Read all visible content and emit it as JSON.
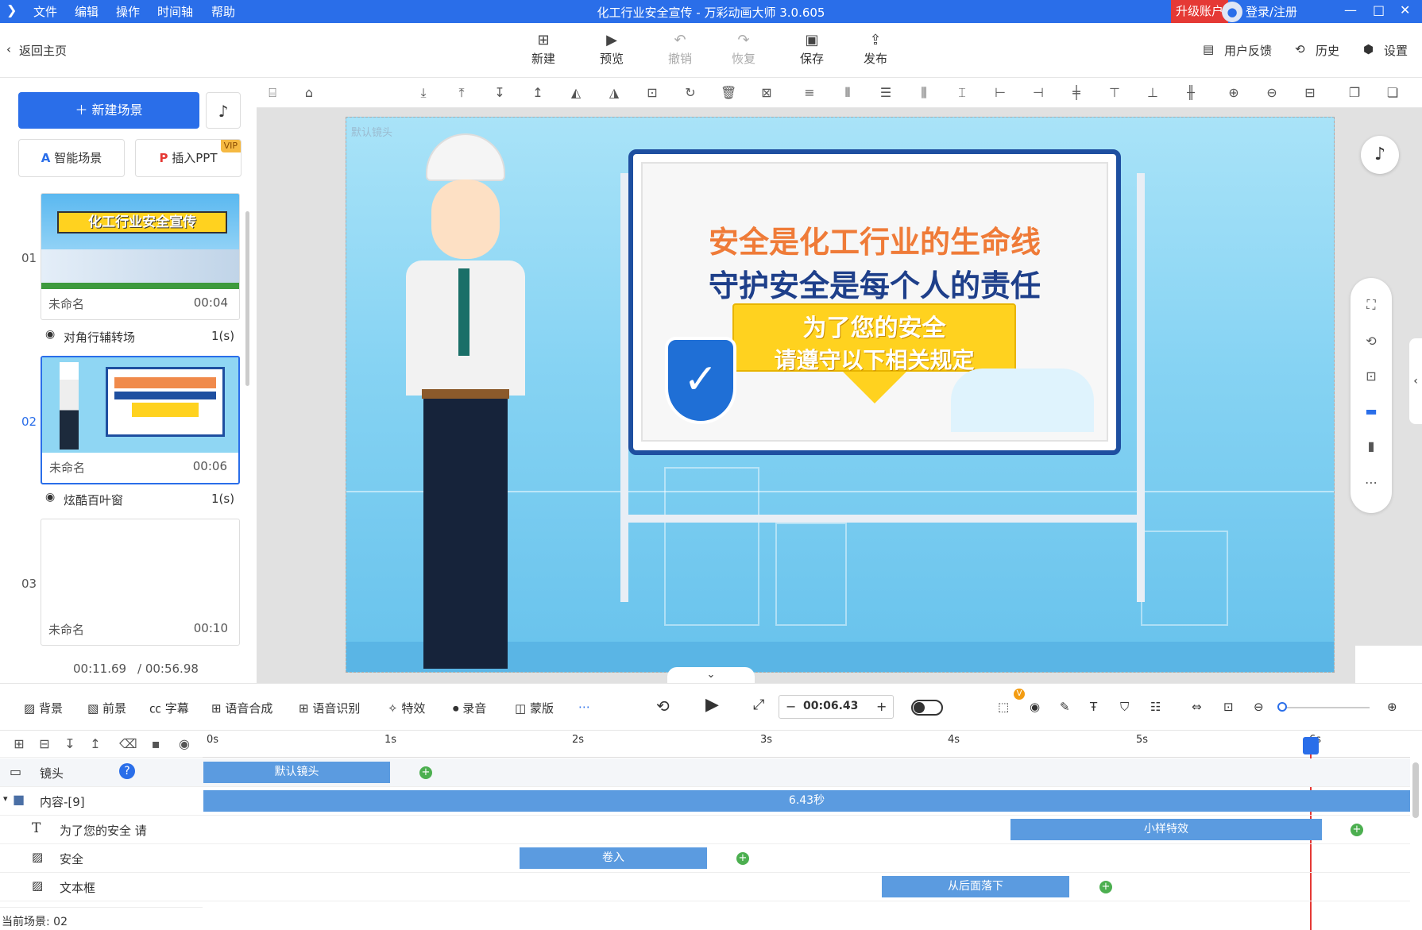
{
  "menu": [
    "文件",
    "编辑",
    "操作",
    "时间轴",
    "帮助"
  ],
  "window_title": "化工行业安全宣传 - 万彩动画大师 3.0.605",
  "upgrade_label": "升级账户",
  "login_label": "登录/注册",
  "back_label": "返回主页",
  "toolbar": {
    "new": "新建",
    "preview": "预览",
    "undo": "撤销",
    "redo": "恢复",
    "save": "保存",
    "publish": "发布"
  },
  "right_links": {
    "feedback": "用户反馈",
    "history": "历史",
    "settings": "设置"
  },
  "left": {
    "new_scene": "新建场景",
    "smart_scene": "智能场景",
    "insert_ppt": "插入PPT",
    "vip": "VIP",
    "scenes": [
      {
        "num": "01",
        "name": "未命名",
        "time": "00:04",
        "banner": "化工行业安全宣传"
      },
      {
        "num": "02",
        "name": "未命名",
        "time": "00:06"
      },
      {
        "num": "03",
        "name": "未命名",
        "time": "00:10"
      }
    ],
    "transitions": [
      {
        "label": "对角行辅转场",
        "dur": "1(s)"
      },
      {
        "label": "炫酷百叶窗",
        "dur": "1(s)"
      }
    ],
    "current_time": "00:11.69",
    "total_time": "/ 00:56.98"
  },
  "stage": {
    "camera_label": "默认镜头",
    "line1": "安全是化工行业的生命线",
    "line2": "守护安全是每个人的责任",
    "banner1": "为了您的安全",
    "banner2": "请遵守以下相关规定"
  },
  "bottom_tools": [
    "背景",
    "前景",
    "字幕",
    "语音合成",
    "语音识别",
    "特效",
    "录音",
    "蒙版"
  ],
  "playhead_time": "00:06.43",
  "ruler": [
    "0s",
    "1s",
    "2s",
    "3s",
    "4s",
    "5s",
    "6s"
  ],
  "tracks": [
    {
      "label": "镜头",
      "clip": "默认镜头"
    },
    {
      "label": "内容-[9]",
      "clip": "6.43秒"
    },
    {
      "label": "为了您的安全 请",
      "clip": "小样特效"
    },
    {
      "label": "安全",
      "clip": "卷入"
    },
    {
      "label": "文本框",
      "clip": "从后面落下"
    }
  ],
  "status": "当前场景: 02",
  "colors": {
    "primary": "#2a6ee9",
    "upgrade": "#e53935",
    "clip": "#5b9be0",
    "keyframe": "#4caf50"
  }
}
